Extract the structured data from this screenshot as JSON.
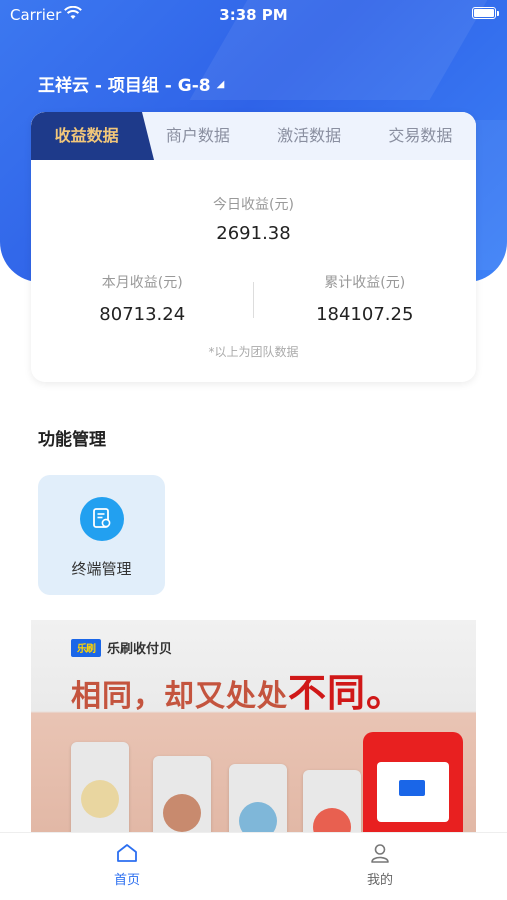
{
  "status_bar": {
    "carrier": "Carrier",
    "time": "3:38 PM"
  },
  "header": {
    "team_title": "王祥云 - 项目组 - G-8"
  },
  "data_card": {
    "tabs": [
      {
        "label": "收益数据",
        "active": true
      },
      {
        "label": "商户数据",
        "active": false
      },
      {
        "label": "激活数据",
        "active": false
      },
      {
        "label": "交易数据",
        "active": false
      }
    ],
    "today_label": "今日收益(元)",
    "today_value": "2691.38",
    "month_label": "本月收益(元)",
    "month_value": "80713.24",
    "total_label": "累计收益(元)",
    "total_value": "184107.25",
    "note": "*以上为团队数据"
  },
  "functions": {
    "title": "功能管理",
    "items": [
      {
        "label": "终端管理",
        "icon": "document-certificate-icon"
      }
    ]
  },
  "banner": {
    "brand_logo": "乐刷",
    "brand_name": "乐刷收付贝",
    "slogan_normal": "相同，却又处处",
    "slogan_big": "不同。"
  },
  "tabbar": {
    "home_label": "首页",
    "mine_label": "我的"
  },
  "colors": {
    "primary": "#2f63e8",
    "active_tab_bg": "#1e3a8a",
    "active_tab_text": "#f2c77a",
    "tabbar_active": "#2c6ff0"
  }
}
